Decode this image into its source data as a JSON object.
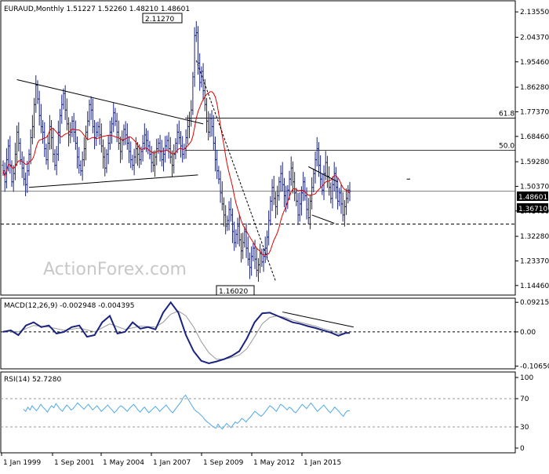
{
  "chart_data": [
    {
      "type": "candlestick",
      "panel": "price",
      "header": "EURAUD,Monthly  1.51227 1.52260 1.48210 1.48601",
      "ylim": [
        1.11,
        2.17
      ],
      "yticks": [
        "2.13550",
        "2.04370",
        "1.95460",
        "1.86280",
        "1.77370",
        "1.68460",
        "1.59280",
        "1.50370",
        "1.41460",
        "1.32280",
        "1.23370",
        "1.14460"
      ],
      "price_labels": {
        "current": "1.48601",
        "support": "1.36710"
      },
      "levels": {
        "current": 1.48601,
        "support": 1.3671,
        "fib_618": 1.751,
        "fib_500": 1.634
      },
      "fib_labels": {
        "fib_618": "61.8",
        "fib_500": "50.0"
      },
      "annotations": {
        "high": "2.11270",
        "low": "1.16020"
      },
      "watermark": "ActionForex.com",
      "ohlc": {
        "start": 1.58,
        "closes": [
          1.56,
          1.52,
          1.6,
          1.65,
          1.58,
          1.52,
          1.55,
          1.62,
          1.7,
          1.66,
          1.6,
          1.57,
          1.53,
          1.51,
          1.56,
          1.62,
          1.68,
          1.72,
          1.8,
          1.87,
          1.82,
          1.76,
          1.72,
          1.7,
          1.64,
          1.6,
          1.66,
          1.72,
          1.68,
          1.62,
          1.58,
          1.62,
          1.7,
          1.76,
          1.8,
          1.84,
          1.78,
          1.73,
          1.69,
          1.7,
          1.74,
          1.7,
          1.66,
          1.61,
          1.58,
          1.56,
          1.6,
          1.64,
          1.7,
          1.74,
          1.8,
          1.78,
          1.72,
          1.68,
          1.7,
          1.72,
          1.69,
          1.65,
          1.61,
          1.57,
          1.62,
          1.66,
          1.7,
          1.73,
          1.77,
          1.74,
          1.7,
          1.66,
          1.63,
          1.67,
          1.71,
          1.69,
          1.66,
          1.63,
          1.6,
          1.58,
          1.61,
          1.64,
          1.62,
          1.6,
          1.63,
          1.66,
          1.69,
          1.67,
          1.65,
          1.62,
          1.59,
          1.58,
          1.61,
          1.64,
          1.66,
          1.63,
          1.6,
          1.62,
          1.65,
          1.67,
          1.64,
          1.61,
          1.58,
          1.62,
          1.66,
          1.7,
          1.68,
          1.65,
          1.62,
          1.64,
          1.68,
          1.72,
          1.75,
          1.78,
          1.9,
          2.05,
          2.06,
          1.95,
          1.88,
          1.92,
          1.85,
          1.8,
          1.74,
          1.7,
          1.75,
          1.72,
          1.66,
          1.6,
          1.56,
          1.53,
          1.48,
          1.44,
          1.4,
          1.36,
          1.38,
          1.42,
          1.4,
          1.34,
          1.3,
          1.33,
          1.36,
          1.31,
          1.27,
          1.3,
          1.34,
          1.28,
          1.24,
          1.21,
          1.25,
          1.28,
          1.24,
          1.2,
          1.22,
          1.26,
          1.23,
          1.25,
          1.28,
          1.32,
          1.38,
          1.45,
          1.5,
          1.46,
          1.43,
          1.47,
          1.52,
          1.55,
          1.51,
          1.47,
          1.44,
          1.49,
          1.53,
          1.57,
          1.52,
          1.48,
          1.45,
          1.4,
          1.44,
          1.48,
          1.52,
          1.47,
          1.42,
          1.39,
          1.45,
          1.5,
          1.55,
          1.6,
          1.64,
          1.58,
          1.53,
          1.49,
          1.55,
          1.59,
          1.54,
          1.5,
          1.46,
          1.51,
          1.55,
          1.5,
          1.45,
          1.48,
          1.44,
          1.4,
          1.43,
          1.46,
          1.49,
          1.48601
        ]
      }
    },
    {
      "type": "line",
      "panel": "macd",
      "header": "MACD(12,26,9) -0.002948 -0.004395",
      "ylim": [
        -0.115,
        0.1
      ],
      "yticks": [
        "0.092158",
        "0.00",
        "-0.106503"
      ],
      "series": [
        {
          "name": "MACD",
          "color": "#1a237e",
          "points": [
            [
              0,
              0.0
            ],
            [
              12,
              0.005
            ],
            [
              24,
              -0.01
            ],
            [
              36,
              0.02
            ],
            [
              48,
              0.03
            ],
            [
              60,
              0.015
            ],
            [
              72,
              0.02
            ],
            [
              84,
              -0.005
            ],
            [
              96,
              0.0
            ],
            [
              108,
              0.015
            ],
            [
              120,
              0.02
            ],
            [
              132,
              -0.015
            ],
            [
              144,
              -0.01
            ],
            [
              156,
              0.03
            ],
            [
              168,
              0.05
            ],
            [
              180,
              -0.005
            ],
            [
              192,
              0.0
            ],
            [
              204,
              0.03
            ],
            [
              216,
              0.01
            ],
            [
              228,
              0.015
            ],
            [
              240,
              0.008
            ],
            [
              252,
              0.06
            ],
            [
              264,
              0.092
            ],
            [
              276,
              0.06
            ],
            [
              288,
              -0.01
            ],
            [
              300,
              -0.06
            ],
            [
              312,
              -0.09
            ],
            [
              324,
              -0.098
            ],
            [
              336,
              -0.092
            ],
            [
              348,
              -0.085
            ],
            [
              360,
              -0.075
            ],
            [
              372,
              -0.06
            ],
            [
              384,
              -0.02
            ],
            [
              396,
              0.03
            ],
            [
              408,
              0.058
            ],
            [
              420,
              0.06
            ],
            [
              432,
              0.05
            ],
            [
              444,
              0.04
            ],
            [
              456,
              0.03
            ],
            [
              468,
              0.025
            ],
            [
              480,
              0.018
            ],
            [
              492,
              0.012
            ],
            [
              504,
              0.005
            ],
            [
              516,
              -0.002
            ],
            [
              528,
              -0.012
            ],
            [
              540,
              -0.003
            ],
            [
              546,
              -0.003
            ]
          ]
        },
        {
          "name": "Signal",
          "color": "#999999",
          "points": [
            [
              0,
              0.003
            ],
            [
              24,
              0.0
            ],
            [
              48,
              0.02
            ],
            [
              72,
              0.015
            ],
            [
              96,
              0.005
            ],
            [
              120,
              0.012
            ],
            [
              144,
              0.0
            ],
            [
              168,
              0.025
            ],
            [
              192,
              0.008
            ],
            [
              216,
              0.018
            ],
            [
              240,
              0.015
            ],
            [
              252,
              0.03
            ],
            [
              264,
              0.055
            ],
            [
              276,
              0.065
            ],
            [
              288,
              0.05
            ],
            [
              300,
              0.015
            ],
            [
              312,
              -0.03
            ],
            [
              324,
              -0.065
            ],
            [
              336,
              -0.085
            ],
            [
              348,
              -0.085
            ],
            [
              360,
              -0.08
            ],
            [
              372,
              -0.072
            ],
            [
              384,
              -0.052
            ],
            [
              396,
              -0.015
            ],
            [
              408,
              0.025
            ],
            [
              420,
              0.045
            ],
            [
              432,
              0.05
            ],
            [
              444,
              0.045
            ],
            [
              456,
              0.037
            ],
            [
              468,
              0.03
            ],
            [
              480,
              0.024
            ],
            [
              492,
              0.018
            ],
            [
              504,
              0.01
            ],
            [
              516,
              0.004
            ],
            [
              528,
              -0.005
            ],
            [
              540,
              -0.004
            ],
            [
              546,
              -0.004
            ]
          ]
        }
      ],
      "trendline": [
        [
          440,
          0.062
        ],
        [
          552,
          0.015
        ]
      ]
    },
    {
      "type": "line",
      "panel": "rsi",
      "header": "RSI(14) 52.7280",
      "ylim": [
        0,
        100
      ],
      "yticks": [
        "100",
        "70",
        "30",
        "0"
      ],
      "levels": [
        70,
        30
      ],
      "series": [
        {
          "name": "RSI(14)",
          "color": "#4fa8e8",
          "values": [
            55,
            52,
            58,
            54,
            60,
            56,
            53,
            57,
            62,
            58,
            55,
            51,
            56,
            60,
            57,
            63,
            59,
            55,
            52,
            57,
            61,
            58,
            54,
            56,
            60,
            64,
            61,
            58,
            55,
            59,
            62,
            58,
            54,
            57,
            60,
            56,
            52,
            55,
            58,
            61,
            57,
            54,
            50,
            53,
            57,
            60,
            58,
            55,
            52,
            56,
            59,
            62,
            58,
            54,
            51,
            55,
            58,
            54,
            50,
            53,
            56,
            59,
            56,
            52,
            55,
            58,
            61,
            57,
            53,
            50,
            54,
            58,
            62,
            66,
            72,
            75,
            70,
            65,
            60,
            55,
            52,
            50,
            47,
            44,
            40,
            37,
            35,
            32,
            30,
            28,
            34,
            30,
            27,
            31,
            35,
            32,
            29,
            33,
            37,
            35,
            38,
            42,
            40,
            37,
            41,
            44,
            48,
            52,
            50,
            47,
            45,
            48,
            52,
            56,
            60,
            58,
            55,
            52,
            57,
            62,
            60,
            57,
            54,
            58,
            56,
            52,
            50,
            54,
            58,
            62,
            59,
            56,
            60,
            64,
            60,
            56,
            52,
            55,
            58,
            61,
            57,
            53,
            50,
            54,
            58,
            55,
            52,
            48,
            45,
            50,
            53,
            52.728
          ]
        }
      ]
    }
  ],
  "x_axis": {
    "labels": [
      "1 Jan 1999",
      "1 Sep 2001",
      "1 May 2004",
      "1 Jan 2007",
      "1 Sep 2009",
      "1 May 2012",
      "1 Jan 2015"
    ]
  }
}
